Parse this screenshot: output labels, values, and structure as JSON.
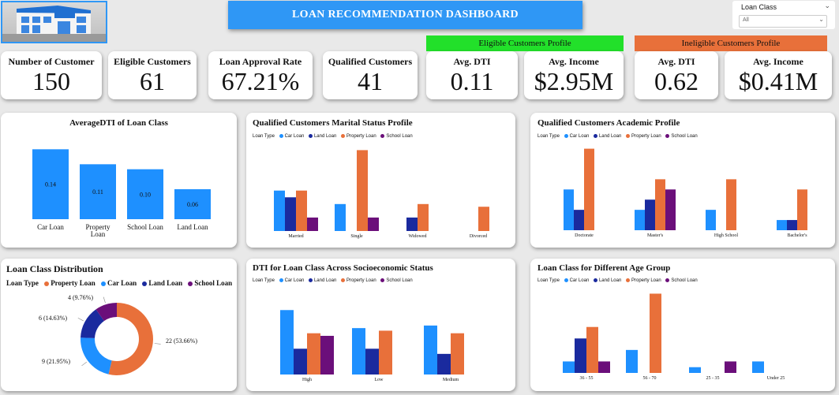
{
  "dashboard_title": "LOAN RECOMMENDATION DASHBOARD",
  "slicer": {
    "label": "Loan Class",
    "value": "All"
  },
  "kpis": {
    "number_of_customer": {
      "label": "Number of Customer",
      "value": "150"
    },
    "eligible_customers": {
      "label": "Eligible Customers",
      "value": "61"
    },
    "approval_rate": {
      "label": "Loan Approval Rate",
      "value": "67.21%"
    },
    "qualified_customers": {
      "label": "Qualified Customers",
      "value": "41"
    },
    "eligible_profile": {
      "header": "Eligible Customers Profile",
      "avg_dti": {
        "label": "Avg. DTI",
        "value": "0.11"
      },
      "avg_income": {
        "label": "Avg. Income",
        "value": "$2.95M"
      }
    },
    "ineligible_profile": {
      "header": "Ineligible Customers Profile",
      "avg_dti": {
        "label": "Avg. DTI",
        "value": "0.62"
      },
      "avg_income": {
        "label": "Avg. Income",
        "value": "$0.41M"
      }
    }
  },
  "colors": {
    "car": "#1e90ff",
    "land": "#1a2a9e",
    "property": "#e8703a",
    "school": "#6b0f7a",
    "banner": "#2f97f5",
    "eligible_header": "#22e02a",
    "ineligible_header": "#e8703a"
  },
  "legend": {
    "loan_type_label": "Loan Type",
    "car": "Car Loan",
    "land": "Land Loan",
    "property": "Property Loan",
    "school": "School Loan"
  },
  "chart_data": [
    {
      "id": "avg_dti",
      "type": "bar",
      "title": "AverageDTI of Loan Class",
      "categories": [
        "Car Loan",
        "Property Loan",
        "School Loan",
        "Land Loan"
      ],
      "values": [
        0.14,
        0.11,
        0.1,
        0.06
      ],
      "data_labels": [
        "0.14",
        "0.11",
        "0.10",
        "0.06"
      ],
      "ylim": [
        0,
        0.15
      ]
    },
    {
      "id": "marital",
      "type": "bar",
      "title": "Qualified Customers Marital Status Profile",
      "categories": [
        "Married",
        "Single",
        "Widowed",
        "Divorced"
      ],
      "series": [
        {
          "name": "Car Loan",
          "values": [
            3,
            2,
            0,
            0
          ]
        },
        {
          "name": "Land Loan",
          "values": [
            2.5,
            0,
            1,
            0
          ]
        },
        {
          "name": "Property Loan",
          "values": [
            3,
            6,
            2,
            1.8
          ]
        },
        {
          "name": "School Loan",
          "values": [
            1,
            1,
            0,
            0
          ]
        }
      ],
      "ylim": [
        0,
        6.2
      ]
    },
    {
      "id": "academic",
      "type": "bar",
      "title": "Qualified Customers Academic Profile",
      "categories": [
        "Doctorate",
        "Master's",
        "High School",
        "Bachelor's"
      ],
      "series": [
        {
          "name": "Car Loan",
          "values": [
            4,
            2,
            2,
            1
          ]
        },
        {
          "name": "Land Loan",
          "values": [
            2,
            3,
            0,
            1
          ]
        },
        {
          "name": "Property Loan",
          "values": [
            8,
            5,
            5,
            4
          ]
        },
        {
          "name": "School Loan",
          "values": [
            0,
            4,
            0,
            0
          ]
        }
      ],
      "ylim": [
        0,
        8.2
      ]
    },
    {
      "id": "distribution",
      "type": "pie",
      "title": "Loan Class Distribution",
      "legend_title": "Loan Type",
      "labels": [
        "Property Loan",
        "Car Loan",
        "Land Loan",
        "School Loan"
      ],
      "values": [
        22,
        9,
        6,
        4
      ],
      "data_labels": [
        "22 (53.66%)",
        "9 (21.95%)",
        "6 (14.63%)",
        "4 (9.76%)"
      ]
    },
    {
      "id": "socio",
      "type": "bar",
      "title": "DTI for Loan Class Across Socioeconomic Status",
      "categories": [
        "High",
        "Low",
        "Medium"
      ],
      "series": [
        {
          "name": "Car Loan",
          "values": [
            0.25,
            0.18,
            0.19
          ]
        },
        {
          "name": "Land Loan",
          "values": [
            0.1,
            0.1,
            0.08
          ]
        },
        {
          "name": "Property Loan",
          "values": [
            0.16,
            0.17,
            0.16
          ]
        },
        {
          "name": "School Loan",
          "values": [
            0.15,
            0,
            0
          ]
        }
      ],
      "ylim": [
        0,
        0.26
      ]
    },
    {
      "id": "age",
      "type": "bar",
      "title": "Loan Class for Different Age Group",
      "categories": [
        "36 - 55",
        "56 - 70",
        "25 - 35",
        "Under 25"
      ],
      "series": [
        {
          "name": "Car Loan",
          "values": [
            1,
            2,
            0.5,
            1
          ]
        },
        {
          "name": "Land Loan",
          "values": [
            3,
            0,
            0,
            0
          ]
        },
        {
          "name": "Property Loan",
          "values": [
            4,
            6.9,
            0,
            0
          ]
        },
        {
          "name": "School Loan",
          "values": [
            1,
            0,
            1,
            0
          ]
        }
      ],
      "ylim": [
        0,
        7
      ]
    }
  ]
}
